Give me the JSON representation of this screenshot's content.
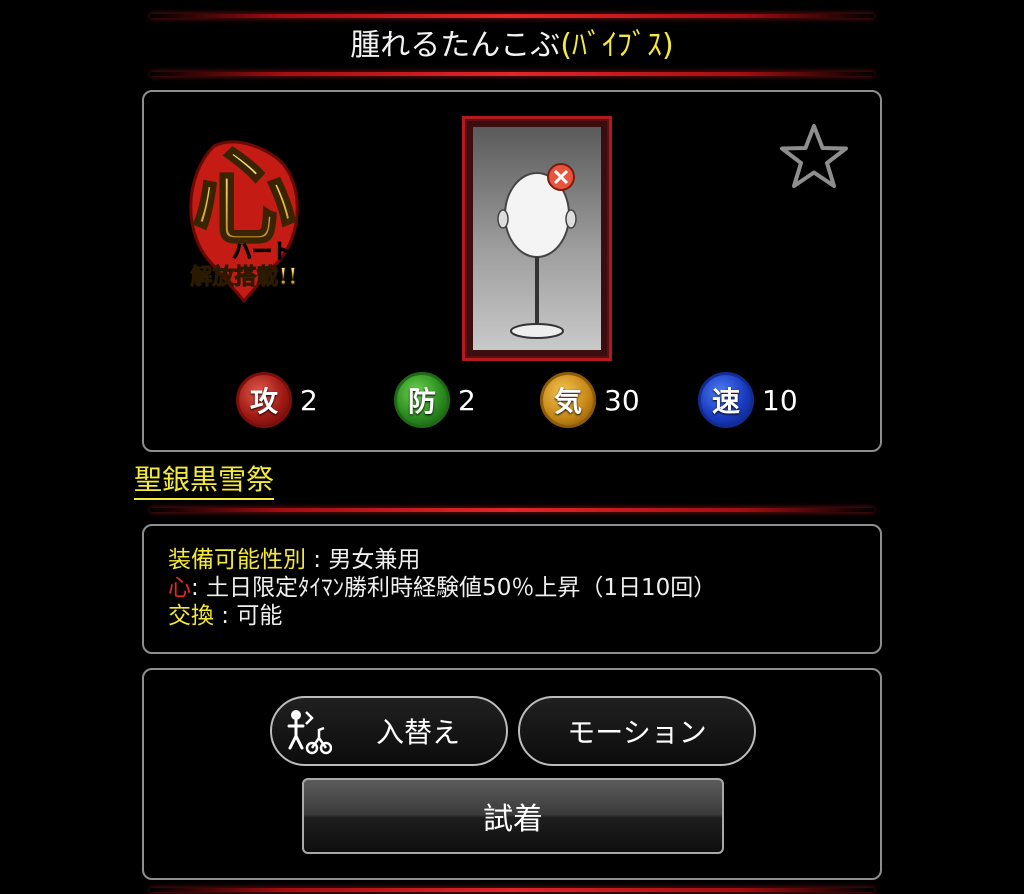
{
  "header": {
    "title": "腫れるたんこぶ",
    "title_suffix": "(ﾊﾞｲﾌﾞｽ)"
  },
  "item": {
    "badge": {
      "icon": "heart-liberation-badge",
      "big_glyph": "心",
      "line1": "ハート",
      "line2": "解放搭載!!"
    },
    "image_icon": "tankobu-bump-icon",
    "favorite_icon": "star-outline-icon",
    "stats": [
      {
        "icon_char": "攻",
        "icon": "attack-icon",
        "value": "2"
      },
      {
        "icon_char": "防",
        "icon": "defense-icon",
        "value": "2"
      },
      {
        "icon_char": "気",
        "icon": "ki-icon",
        "value": "30"
      },
      {
        "icon_char": "速",
        "icon": "speed-icon",
        "value": "10"
      }
    ]
  },
  "set_name": "聖銀黒雪祭",
  "info": {
    "gender_label": "装備可能性別",
    "gender_sep": " : ",
    "gender_value": "男女兼用",
    "heart_label": "心",
    "heart_value": ": 土日限定ﾀｲﾏﾝ勝利時経験値50％上昇（1日10回）",
    "trade_label": "交換",
    "trade_sep": " : ",
    "trade_value": "可能"
  },
  "actions": {
    "swap_label": "入替え",
    "motion_label": "モーション",
    "try_on_label": "試着"
  },
  "colors": {
    "accent_yellow": "#f4ea38",
    "accent_red": "#e2262a",
    "panel_border": "#8e8e8e"
  }
}
